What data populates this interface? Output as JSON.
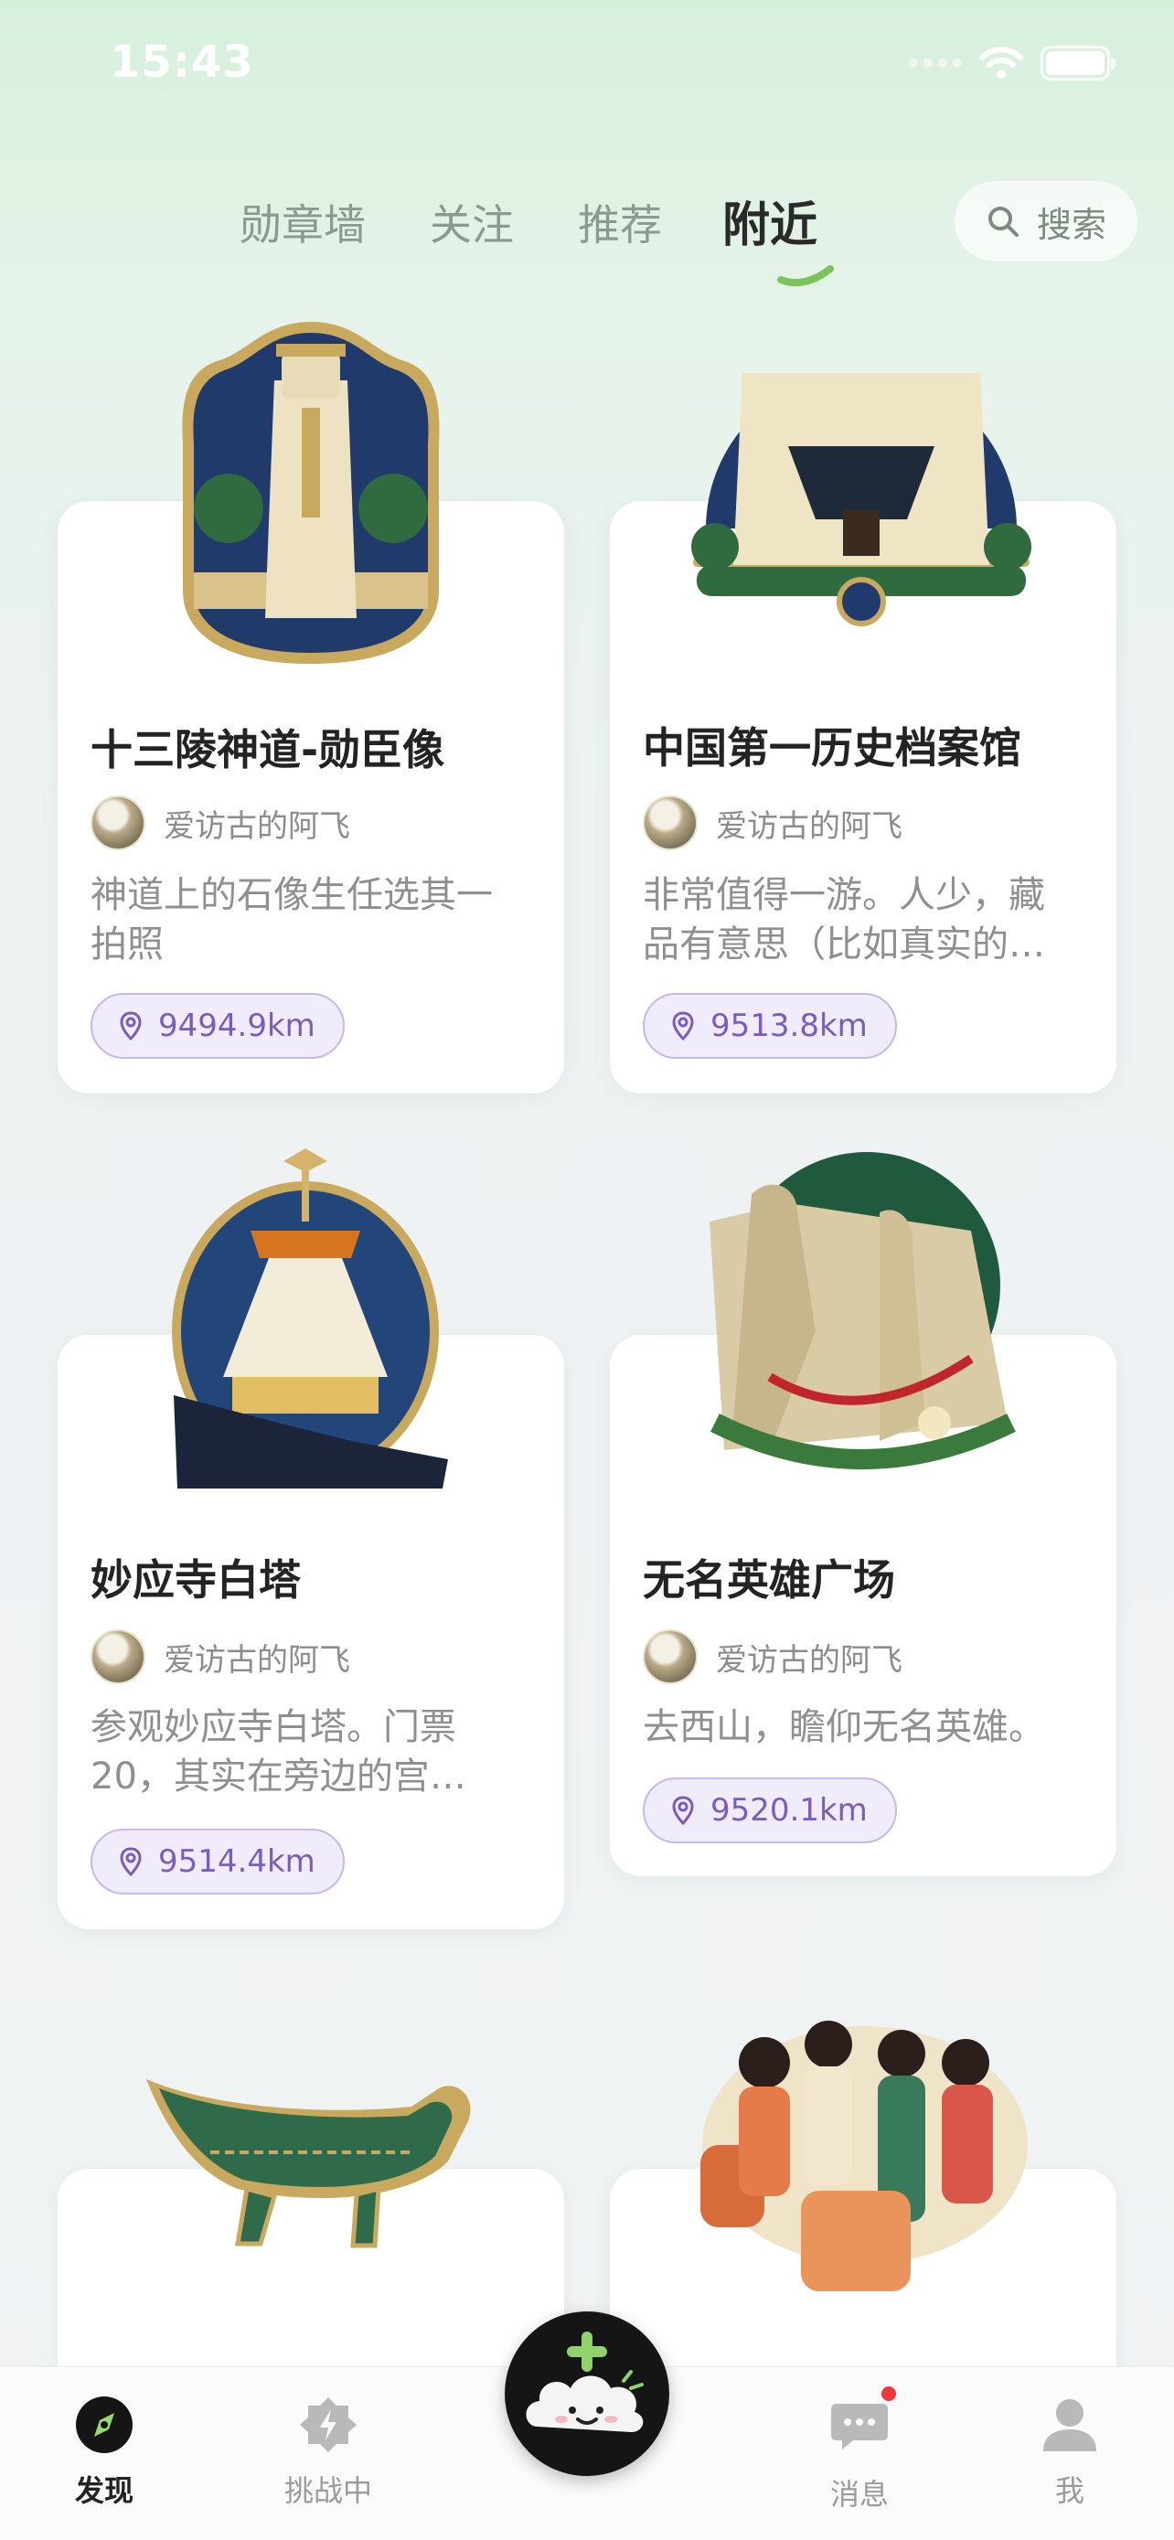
{
  "status_bar": {
    "time": "15:43"
  },
  "tabs": [
    {
      "label": "勋章墙",
      "active": false
    },
    {
      "label": "关注",
      "active": false
    },
    {
      "label": "推荐",
      "active": false
    },
    {
      "label": "附近",
      "active": true
    }
  ],
  "search": {
    "label": "搜索",
    "icon": "search-icon"
  },
  "cards": [
    {
      "title": "十三陵神道-勋臣像",
      "author": "爱访古的阿飞",
      "desc_lines": [
        "神道上的石像生任选其一",
        "拍照"
      ],
      "distance": "9494.9km",
      "badge": "statue-badge"
    },
    {
      "title": "中国第一历史档案馆",
      "author": "爱访古的阿飞",
      "desc_lines": [
        "非常值得一游。人少，藏",
        "品有意思（比如真实的…"
      ],
      "distance": "9513.8km",
      "badge": "archive-building-badge"
    },
    {
      "title": "妙应寺白塔",
      "author": "爱访古的阿飞",
      "desc_lines": [
        "参观妙应寺白塔。门票",
        "20，其实在旁边的宫…"
      ],
      "distance": "9514.4km",
      "badge": "white-pagoda-badge"
    },
    {
      "title": "无名英雄广场",
      "author": "爱访古的阿飞",
      "desc_lines": [
        "去西山，瞻仰无名英雄。"
      ],
      "distance": "9520.1km",
      "badge": "heroes-plaza-badge"
    },
    {
      "badge": "bronze-vessel-badge"
    },
    {
      "badge": "musicians-badge"
    }
  ],
  "bottom_nav": [
    {
      "label": "发现",
      "active": true,
      "icon": "compass-icon"
    },
    {
      "label": "挑战中",
      "active": false,
      "icon": "challenge-icon"
    },
    {
      "label": "消息",
      "active": false,
      "icon": "message-icon",
      "unread": true
    },
    {
      "label": "我",
      "active": false,
      "icon": "profile-icon"
    }
  ],
  "fab": {
    "icon": "add-cloud-icon"
  },
  "colors": {
    "accent_green": "#7cc35a",
    "distance_purple": "#7a5cc1",
    "notification_red": "#f0383c"
  }
}
